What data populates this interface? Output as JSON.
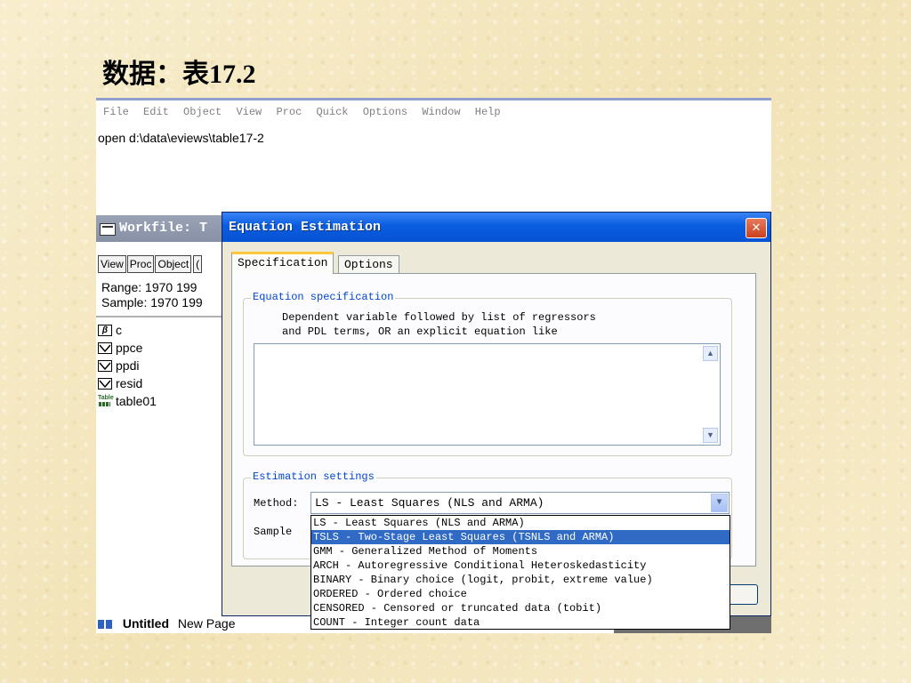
{
  "slide_title": "数据：表17.2",
  "menu": [
    "File",
    "Edit",
    "Object",
    "View",
    "Proc",
    "Quick",
    "Options",
    "Window",
    "Help"
  ],
  "command": "open d:\\data\\eviews\\table17-2",
  "workfile": {
    "title": "Workfile: T",
    "buttons": [
      "View",
      "Proc",
      "Object",
      "("
    ],
    "range": "Range:  1970 199",
    "sample": "Sample: 1970 199",
    "objects": [
      {
        "name": "c",
        "icon": "coef-icon"
      },
      {
        "name": "ppce",
        "icon": "series-icon"
      },
      {
        "name": "ppdi",
        "icon": "series-icon"
      },
      {
        "name": "resid",
        "icon": "series-icon"
      },
      {
        "name": "table01",
        "icon": "table-icon"
      }
    ],
    "tabs": [
      "Untitled",
      "New Page"
    ]
  },
  "dialog": {
    "title": "Equation Estimation",
    "close_glyph": "✕",
    "tabs": [
      "Specification",
      "Options"
    ],
    "eq_group_label": "Equation specification",
    "help_line1": "Dependent variable followed by list of regressors",
    "help_line2": "and PDL terms, OR an explicit equation like",
    "equation_value": "",
    "est_group_label": "Estimation settings",
    "method_label": "Method:",
    "method_value": "LS  -  Least Squares (NLS and ARMA)",
    "sample_label": "Sample",
    "method_options": [
      "LS  -  Least Squares (NLS and ARMA)",
      "TSLS  -  Two-Stage Least Squares (TSNLS and ARMA)",
      "GMM  -  Generalized Method of Moments",
      "ARCH  -  Autoregressive Conditional Heteroskedasticity",
      "BINARY  -  Binary choice (logit, probit, extreme value)",
      "ORDERED  -  Ordered choice",
      "CENSORED  -  Censored or truncated data (tobit)",
      "COUNT  -  Integer count data"
    ],
    "highlighted_option": 1
  }
}
